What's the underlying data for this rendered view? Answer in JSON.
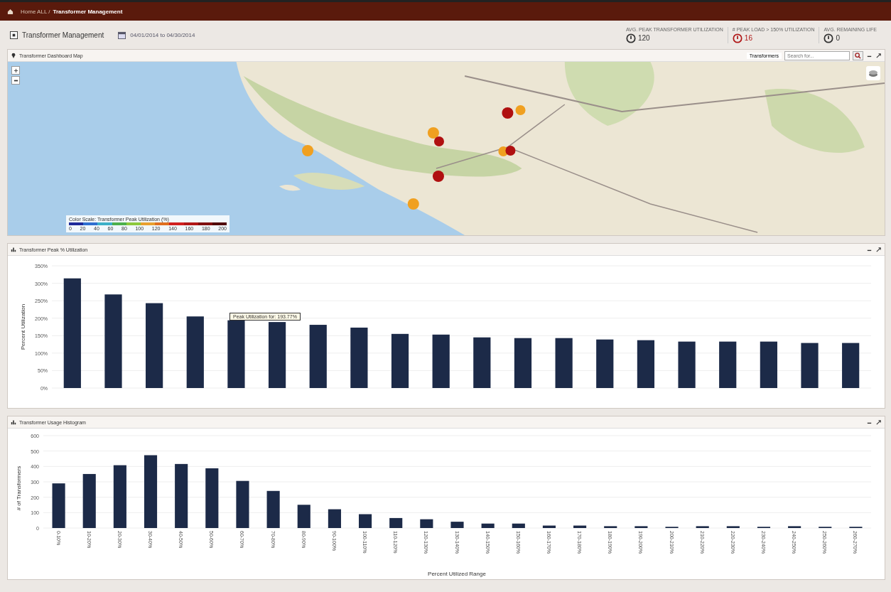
{
  "top_bar": {
    "breadcrumb_root": "Home ALL /",
    "breadcrumb_current": "Transformer Management"
  },
  "header": {
    "title": "Transformer Management",
    "date_range": "04/01/2014 to 04/30/2014",
    "kpis": [
      {
        "label": "AVG. PEAK TRANSFORMER UTILIZATION",
        "value": "120",
        "alert": false
      },
      {
        "label": "# PEAK LOAD > 150% UTILIZATION",
        "value": "16",
        "alert": true
      },
      {
        "label": "AVG. REMAINING LIFE",
        "value": "0",
        "alert": false
      }
    ]
  },
  "map_panel": {
    "title": "Transformer Dashboard Map",
    "layer_dropdown": "Transformers",
    "search": {
      "placeholder": "Search for..."
    },
    "legend": {
      "title": "Color Scale: Transformer Peak Utilization (%)",
      "ticks": [
        "0",
        "20",
        "40",
        "60",
        "80",
        "100",
        "120",
        "140",
        "160",
        "180",
        "200"
      ]
    }
  },
  "peak_panel": {
    "title": "Transformer Peak % Utilization",
    "chart_data": {
      "type": "bar",
      "ylabel": "Percent Utilization",
      "ylim": [
        0,
        350
      ],
      "yticks": [
        {
          "value": 0,
          "label": "0%"
        },
        {
          "value": 50,
          "label": "50%"
        },
        {
          "value": 100,
          "label": "100%"
        },
        {
          "value": 150,
          "label": "150%"
        },
        {
          "value": 200,
          "label": "200%"
        },
        {
          "value": 250,
          "label": "250%"
        },
        {
          "value": 300,
          "label": "300%"
        },
        {
          "value": 350,
          "label": "350%"
        }
      ],
      "grid": true,
      "series": [
        {
          "color": "#1c2a48",
          "values": [
            314,
            268,
            243,
            205,
            194,
            189,
            181,
            173,
            155,
            153,
            145,
            143,
            143,
            139,
            137,
            133,
            133,
            133,
            129,
            129
          ]
        }
      ]
    },
    "tooltip": {
      "text": "Peak Utilization for: 193.77%"
    }
  },
  "histogram_panel": {
    "title": "Transformer Usage Histogram",
    "chart_data": {
      "type": "bar",
      "ylabel": "# of Transformers",
      "xlabel": "Percent Utilized Range",
      "ylim": [
        0,
        600
      ],
      "yticks": [
        0,
        100,
        200,
        300,
        400,
        500,
        600
      ],
      "categories": [
        "0-10%",
        "10-20%",
        "20-30%",
        "30-40%",
        "40-50%",
        "50-60%",
        "60-70%",
        "70-80%",
        "80-90%",
        "90-100%",
        "100-110%",
        "110-120%",
        "120-130%",
        "130-140%",
        "140-150%",
        "150-160%",
        "160-170%",
        "170-180%",
        "180-190%",
        "190-200%",
        "200-210%",
        "210-220%",
        "220-230%",
        "230-240%",
        "240-250%",
        "250-260%",
        "260-270%"
      ],
      "grid": true,
      "series": [
        {
          "color": "#1c2a48",
          "values": [
            290,
            351,
            408,
            473,
            416,
            388,
            306,
            241,
            151,
            122,
            90,
            65,
            57,
            41,
            29,
            29,
            16,
            16,
            12,
            12,
            8,
            12,
            12,
            8,
            12,
            8,
            8
          ]
        }
      ]
    }
  }
}
